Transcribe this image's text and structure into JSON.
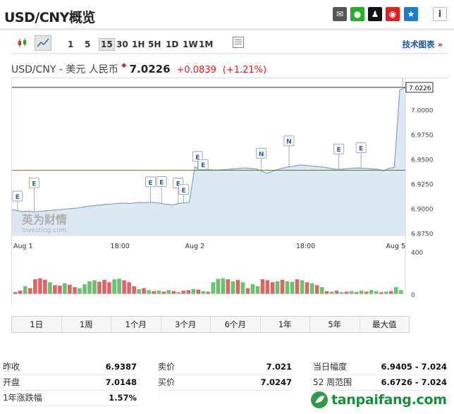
{
  "header": {
    "title": "USD/CNY概览",
    "share_icons": [
      {
        "name": "email-icon",
        "bg": "#555555",
        "glyph": "✉"
      },
      {
        "name": "wechat-icon",
        "bg": "#2aae2a",
        "glyph": "●"
      },
      {
        "name": "qq-icon",
        "bg": "#111111",
        "glyph": "♟"
      },
      {
        "name": "weibo-icon",
        "bg": "#e02020",
        "glyph": "◉"
      },
      {
        "name": "qzone-icon",
        "bg": "#1f7ad4",
        "glyph": "★"
      }
    ],
    "info_glyph": "i"
  },
  "toolbar": {
    "intervals": [
      "1",
      "5",
      "15",
      "30",
      "1H",
      "5H",
      "1D",
      "1W",
      "1M"
    ],
    "active_interval": "15",
    "tech_chart_label": "技术图表 »"
  },
  "quote": {
    "name": "USD/CNY - 美元 人民币",
    "price": "7.0226",
    "change": "+0.0839",
    "change_pct": "(+1.21%)",
    "up_color": "#e21b1b"
  },
  "chart_data": {
    "type": "area",
    "x_ticks": [
      "Aug 1",
      "18:00",
      "Aug 2",
      "18:00",
      "Aug 5"
    ],
    "y_ticks": [
      "7.0000",
      "6.9750",
      "6.9500",
      "6.9250",
      "6.9000",
      "6.8750"
    ],
    "ylim": [
      6.8725,
      7.0275
    ],
    "last_value_label": "7.0226",
    "reference_line": 6.9387,
    "series": [
      {
        "values": [
          6.899,
          6.8975,
          6.8968,
          6.8972,
          6.8965,
          6.897,
          6.8975,
          6.898,
          6.8985,
          6.899,
          6.8995,
          6.9,
          6.9005,
          6.9015,
          6.9022,
          6.903,
          6.9035,
          6.904,
          6.9045,
          6.905,
          6.9055,
          6.905,
          6.9055,
          6.906,
          6.9058,
          6.9062,
          6.9058,
          6.905,
          6.904,
          6.9035,
          6.905,
          6.9055,
          6.906,
          6.942,
          6.939,
          6.9395,
          6.939,
          6.9388,
          6.9392,
          6.9395,
          6.94,
          6.9405,
          6.941,
          6.9405,
          6.94,
          6.938,
          6.9355,
          6.9375,
          6.9395,
          6.941,
          6.942,
          6.943,
          6.944,
          6.9435,
          6.943,
          6.9425,
          6.942,
          6.941,
          6.94,
          6.9395,
          6.94,
          6.9405,
          6.941,
          6.9408,
          6.9405,
          6.94,
          6.9398,
          6.938,
          6.9405,
          6.9415,
          7.02,
          7.0226
        ]
      }
    ],
    "event_markers": [
      "E",
      "E",
      "E",
      "E",
      "E",
      "E",
      "E",
      "E",
      "N",
      "N",
      "E",
      "E",
      "E"
    ],
    "volume_axis_ticks": [
      "400",
      "0"
    ],
    "volume": [
      {
        "v": 20,
        "c": "red"
      },
      {
        "v": 35,
        "c": "red"
      },
      {
        "v": 80,
        "c": "green"
      },
      {
        "v": 60,
        "c": "red"
      },
      {
        "v": 150,
        "c": "red"
      },
      {
        "v": 160,
        "c": "red"
      },
      {
        "v": 145,
        "c": "red"
      },
      {
        "v": 120,
        "c": "green"
      },
      {
        "v": 90,
        "c": "red"
      },
      {
        "v": 85,
        "c": "red"
      },
      {
        "v": 110,
        "c": "green"
      },
      {
        "v": 95,
        "c": "red"
      },
      {
        "v": 70,
        "c": "red"
      },
      {
        "v": 60,
        "c": "green"
      },
      {
        "v": 100,
        "c": "green"
      },
      {
        "v": 130,
        "c": "green"
      },
      {
        "v": 140,
        "c": "green"
      },
      {
        "v": 125,
        "c": "red"
      },
      {
        "v": 145,
        "c": "red"
      },
      {
        "v": 120,
        "c": "red"
      },
      {
        "v": 150,
        "c": "green"
      },
      {
        "v": 155,
        "c": "green"
      },
      {
        "v": 140,
        "c": "red"
      },
      {
        "v": 120,
        "c": "red"
      },
      {
        "v": 80,
        "c": "red"
      },
      {
        "v": 50,
        "c": "green"
      },
      {
        "v": 60,
        "c": "red"
      },
      {
        "v": 40,
        "c": "green"
      },
      {
        "v": 30,
        "c": "red"
      },
      {
        "v": 35,
        "c": "green"
      },
      {
        "v": 25,
        "c": "red"
      },
      {
        "v": 40,
        "c": "green"
      },
      {
        "v": 30,
        "c": "red"
      },
      {
        "v": 20,
        "c": "green"
      },
      {
        "v": 35,
        "c": "red"
      },
      {
        "v": 40,
        "c": "red"
      },
      {
        "v": 50,
        "c": "green"
      },
      {
        "v": 45,
        "c": "red"
      },
      {
        "v": 30,
        "c": "green"
      },
      {
        "v": 25,
        "c": "red"
      },
      {
        "v": 120,
        "c": "green"
      },
      {
        "v": 155,
        "c": "green"
      },
      {
        "v": 160,
        "c": "green"
      },
      {
        "v": 150,
        "c": "red"
      },
      {
        "v": 130,
        "c": "green"
      },
      {
        "v": 145,
        "c": "red"
      },
      {
        "v": 120,
        "c": "green"
      },
      {
        "v": 60,
        "c": "red"
      },
      {
        "v": 100,
        "c": "green"
      },
      {
        "v": 80,
        "c": "green"
      },
      {
        "v": 150,
        "c": "red"
      },
      {
        "v": 140,
        "c": "red"
      },
      {
        "v": 120,
        "c": "red"
      },
      {
        "v": 130,
        "c": "green"
      },
      {
        "v": 145,
        "c": "red"
      },
      {
        "v": 130,
        "c": "green"
      },
      {
        "v": 125,
        "c": "green"
      },
      {
        "v": 150,
        "c": "red"
      },
      {
        "v": 140,
        "c": "green"
      },
      {
        "v": 120,
        "c": "red"
      },
      {
        "v": 110,
        "c": "green"
      },
      {
        "v": 90,
        "c": "red"
      },
      {
        "v": 70,
        "c": "green"
      },
      {
        "v": 30,
        "c": "red"
      },
      {
        "v": 25,
        "c": "green"
      },
      {
        "v": 35,
        "c": "red"
      },
      {
        "v": 20,
        "c": "green"
      },
      {
        "v": 25,
        "c": "red"
      },
      {
        "v": 30,
        "c": "green"
      },
      {
        "v": 20,
        "c": "red"
      },
      {
        "v": 35,
        "c": "green"
      },
      {
        "v": 25,
        "c": "red"
      },
      {
        "v": 40,
        "c": "green"
      },
      {
        "v": 30,
        "c": "green"
      },
      {
        "v": 20,
        "c": "red"
      },
      {
        "v": 25,
        "c": "green"
      },
      {
        "v": 30,
        "c": "red"
      },
      {
        "v": 70,
        "c": "green"
      },
      {
        "v": 40,
        "c": "green"
      }
    ],
    "colors": {
      "line": "#7fa3c6",
      "area": "#dde8f2",
      "ref": "#e03030",
      "vol_up": "#6cc070",
      "vol_down": "#d86868"
    }
  },
  "range_tabs": [
    "1日",
    "1周",
    "1个月",
    "3个月",
    "6个月",
    "1年",
    "5年",
    "最大值"
  ],
  "stats": {
    "col1": [
      {
        "label": "昨收",
        "value": "6.9387"
      },
      {
        "label": "开盘",
        "value": "7.0148"
      },
      {
        "label": "1年涨跌幅",
        "value": "1.57%"
      }
    ],
    "col2": [
      {
        "label": "卖价",
        "value": "7.021"
      },
      {
        "label": "买价",
        "value": "7.0247"
      }
    ],
    "col3": [
      {
        "label": "当日幅度",
        "value": "6.9405 - 7.024"
      },
      {
        "label": "52 周范围",
        "value": "6.6726 - 7.024"
      }
    ]
  },
  "watermark": {
    "investing_logo": "英为财情 Investing.com",
    "site": "tanpaifang.com"
  }
}
